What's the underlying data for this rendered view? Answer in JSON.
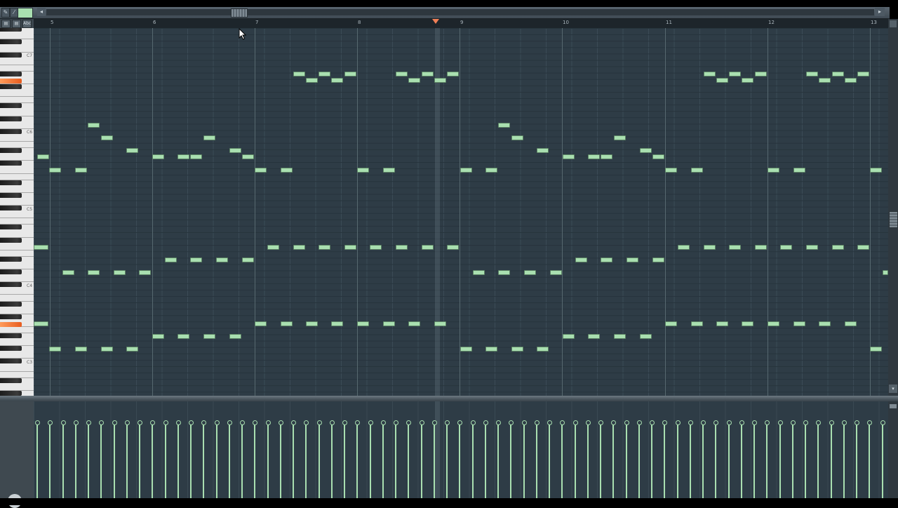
{
  "app": {
    "name": "Piano roll"
  },
  "toolbar": {
    "tool_draw_icon": "pencil-icon",
    "tool_paint_icon": "brush-icon",
    "scroll_left_glyph": "◂",
    "scroll_right_glyph": "▸"
  },
  "piano_header": {
    "buttons": [
      {
        "name": "view-toggle-1",
        "glyph": "▤"
      },
      {
        "name": "view-toggle-2",
        "glyph": "▤"
      },
      {
        "name": "keyboard-mode",
        "glyph": "Abc"
      }
    ]
  },
  "ruler": {
    "bars": [
      "5",
      "6",
      "7",
      "8",
      "9",
      "10",
      "11",
      "12",
      "13"
    ]
  },
  "piano_keys": {
    "octave_labels": [
      "C7",
      "C6",
      "C5",
      "C4",
      "C3"
    ],
    "active_keys": 2
  },
  "colors": {
    "note_fill": "#a9dfb0",
    "grid_bg": "#2e3c46",
    "playhead_marker": "#f07f56",
    "active_key": "#e85d20"
  },
  "notes_count": 107,
  "velocity": {
    "level": 1.0,
    "events": 67
  }
}
